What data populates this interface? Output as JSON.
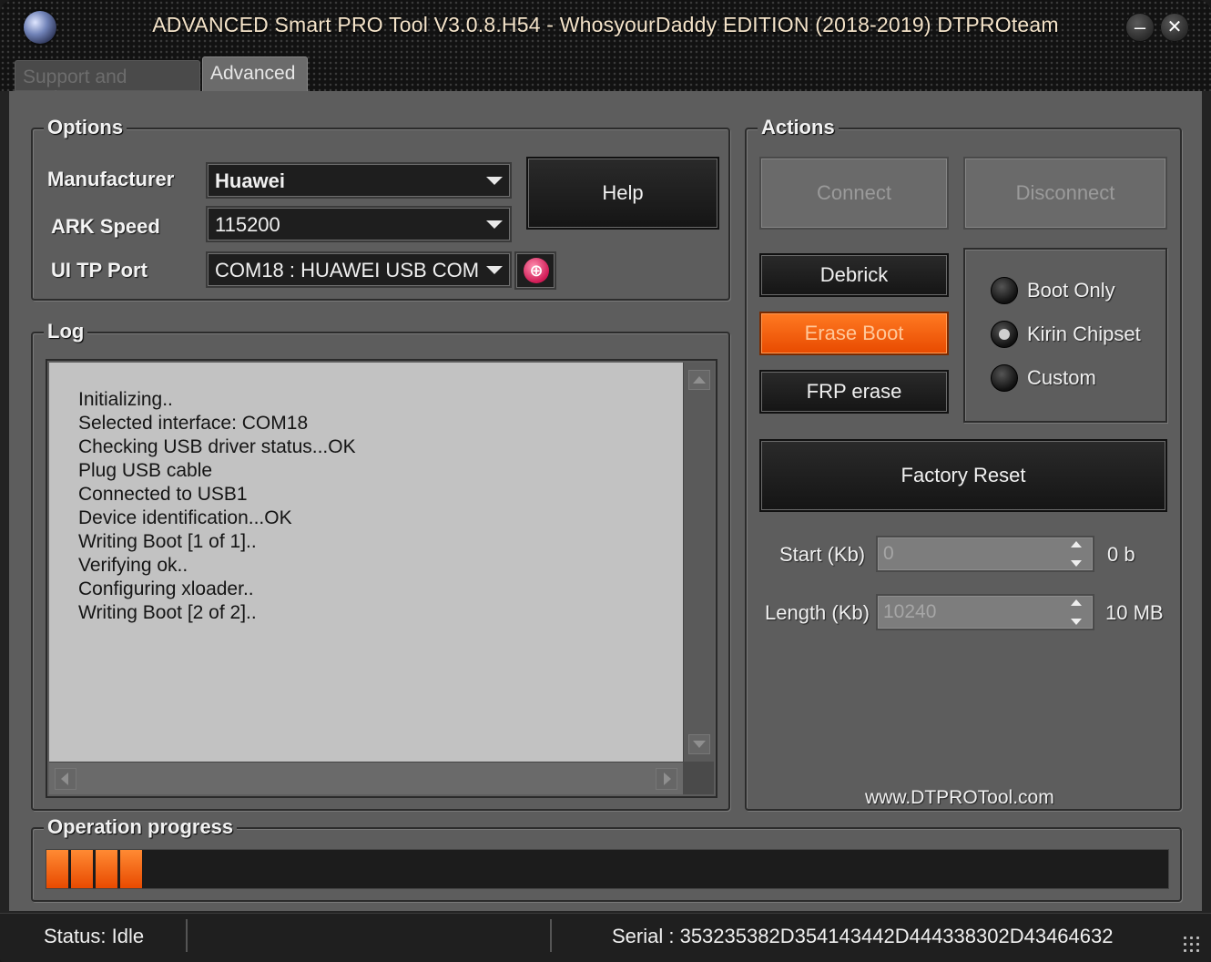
{
  "window": {
    "title": "ADVANCED Smart PRO Tool V3.0.8.H54 - WhosyourDaddy EDITION (2018-2019) DTPROteam",
    "minimize_glyph": "–",
    "close_glyph": "✕"
  },
  "tabs": [
    {
      "label": "Support and Options",
      "active": false
    },
    {
      "label": "Advanced",
      "active": true
    }
  ],
  "options": {
    "legend": "Options",
    "manufacturer_label": "Manufacturer",
    "manufacturer_value": "Huawei",
    "ark_speed_label": "ARK Speed",
    "ark_speed_value": "115200",
    "port_label": "UI TP Port",
    "port_value": "COM18 : HUAWEI USB COM",
    "help_label": "Help",
    "refresh_glyph": "⊕"
  },
  "log": {
    "legend": "Log",
    "lines": [
      "Initializing..",
      "Selected interface: COM18",
      "Checking USB driver status...OK",
      "Plug USB cable",
      "Connected to USB1",
      "Device identification...OK",
      "Writing Boot [1 of 1]..",
      "Verifying ok..",
      "Configuring xloader..",
      "Writing Boot [2 of 2].."
    ]
  },
  "actions": {
    "legend": "Actions",
    "connect_label": "Connect",
    "disconnect_label": "Disconnect",
    "debrick_label": "Debrick",
    "erase_boot_label": "Erase Boot",
    "frp_erase_label": "FRP erase",
    "factory_reset_label": "Factory Reset",
    "radio_options": [
      {
        "label": "Boot Only",
        "checked": false
      },
      {
        "label": "Kirin Chipset",
        "checked": true
      },
      {
        "label": "Custom",
        "checked": false
      }
    ],
    "start_label": "Start (Kb)",
    "start_value": "0",
    "start_unit": "0 b",
    "length_label": "Length (Kb)",
    "length_value": "10240",
    "length_unit": "10 MB",
    "website": "www.DTPROTool.com"
  },
  "progress": {
    "legend": "Operation progress",
    "segments_filled": 4,
    "fill_fraction": 0.09
  },
  "statusbar": {
    "status": "Status: Idle",
    "middle": "",
    "serial": "Serial : 353235382D354143442D444338302D43464632"
  },
  "colors": {
    "accent_orange": "#ff6a10",
    "panel_bg": "#5d5d5d",
    "log_bg": "#c2c2c2"
  }
}
